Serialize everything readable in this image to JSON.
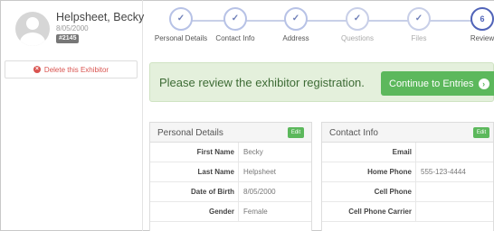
{
  "exhibitor": {
    "name": "Helpsheet, Becky",
    "dob": "8/05/2000",
    "id_badge": "#2145",
    "delete_label": "Delete this Exhibitor"
  },
  "steps": [
    {
      "label": "Personal Details",
      "icon": "check-icon",
      "symbol": "✓",
      "state": "done"
    },
    {
      "label": "Contact Info",
      "icon": "check-icon",
      "symbol": "✓",
      "state": "done"
    },
    {
      "label": "Address",
      "icon": "check-icon",
      "symbol": "✓",
      "state": "done"
    },
    {
      "label": "Questions",
      "icon": "check-icon",
      "symbol": "✓",
      "state": "todo"
    },
    {
      "label": "Files",
      "icon": "check-icon",
      "symbol": "✓",
      "state": "todo"
    },
    {
      "label": "Review",
      "icon": "number",
      "symbol": "6",
      "state": "current"
    }
  ],
  "alert": {
    "text": "Please review the exhibitor registration.",
    "continue_label": "Continue to Entries"
  },
  "personal_details": {
    "title": "Personal Details",
    "edit_label": "Edit",
    "rows": [
      {
        "label": "First Name",
        "value": "Becky"
      },
      {
        "label": "Last Name",
        "value": "Helpsheet"
      },
      {
        "label": "Date of Birth",
        "value": "8/05/2000"
      },
      {
        "label": "Gender",
        "value": "Female"
      }
    ]
  },
  "contact_info": {
    "title": "Contact Info",
    "edit_label": "Edit",
    "rows": [
      {
        "label": "Email",
        "value": ""
      },
      {
        "label": "Home Phone",
        "value": "555-123-4444"
      },
      {
        "label": "Cell Phone",
        "value": ""
      },
      {
        "label": "Cell Phone Carrier",
        "value": ""
      }
    ]
  },
  "colors": {
    "accent_green": "#5cb85c",
    "delete_red": "#d9534f",
    "step_blue": "#5063b8",
    "alert_bg": "#e4f0dc"
  }
}
